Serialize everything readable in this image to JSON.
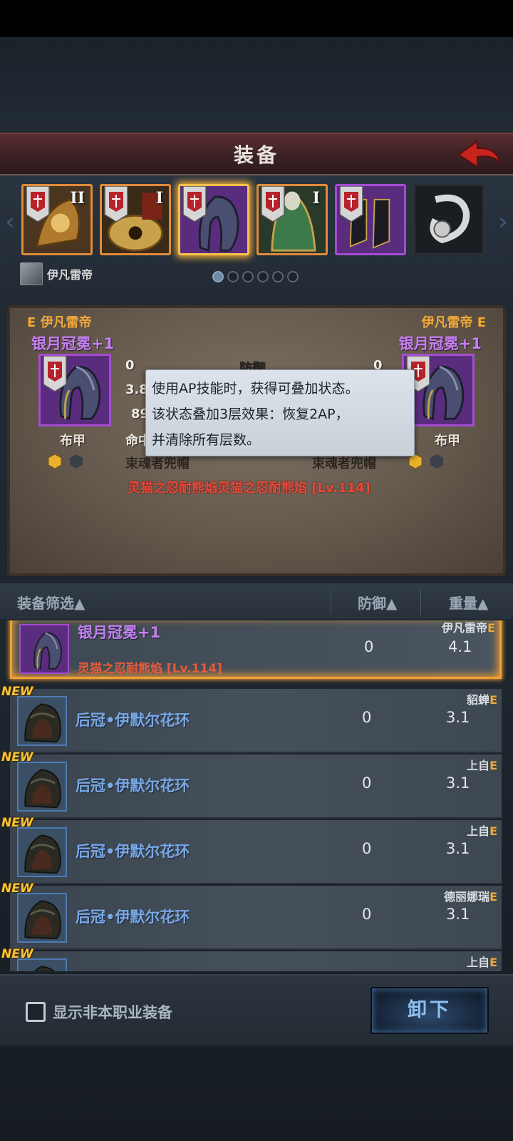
{
  "header": {
    "title": "装备"
  },
  "slots": [
    {
      "tier": "II",
      "border": "orange"
    },
    {
      "tier": "I",
      "border": "orange"
    },
    {
      "tier": "",
      "border": "orange",
      "selected": true
    },
    {
      "tier": "I",
      "border": "orange"
    },
    {
      "tier": "",
      "border": "purple"
    },
    {
      "tier": "",
      "border": "gray"
    }
  ],
  "character": {
    "name": "伊凡雷帝"
  },
  "pager": {
    "count": 6,
    "active": 0
  },
  "compare": {
    "left": {
      "owner": "E 伊凡雷帝",
      "item_name": "银月冠冕+1",
      "type": "布甲",
      "stats": [
        "0",
        "3.8",
        "89",
        "命中"
      ],
      "set": "束魂者兜帽"
    },
    "right": {
      "owner": "伊凡雷帝 E",
      "item_name": "银月冠冕+1",
      "type": "布甲",
      "stats": [
        "0",
        "",
        ""
      ],
      "set": "束魂者兜帽"
    },
    "center_label": "防御",
    "skill": "灵猫之忍耐熊焰灵猫之忍耐熊焰 [Lv.114]"
  },
  "tooltip": {
    "lines": [
      "使用AP技能时，获得可叠加状态。",
      "该状态叠加3层效果：恢复2AP，",
      "并清除所有层数。"
    ]
  },
  "list_header": {
    "filter": "装备筛选▲",
    "defense": "防御▲",
    "weight": "重量▲"
  },
  "items": [
    {
      "name": "银月冠冕+1",
      "skill": "灵猫之忍耐熊焰 [Lv.114]",
      "owner": "伊凡雷帝",
      "grade": "E",
      "defense": "0",
      "weight": "4.1",
      "is_new": false,
      "selected": true
    },
    {
      "name": "后冠•伊默尔花环",
      "skill": "",
      "owner": "貂蝉",
      "grade": "E",
      "defense": "0",
      "weight": "3.1",
      "is_new": true,
      "selected": false
    },
    {
      "name": "后冠•伊默尔花环",
      "skill": "",
      "owner": "上自",
      "grade": "E",
      "defense": "0",
      "weight": "3.1",
      "is_new": true,
      "selected": false
    },
    {
      "name": "后冠•伊默尔花环",
      "skill": "",
      "owner": "上自",
      "grade": "E",
      "defense": "0",
      "weight": "3.1",
      "is_new": true,
      "selected": false
    },
    {
      "name": "后冠•伊默尔花环",
      "skill": "",
      "owner": "德丽娜瑞",
      "grade": "E",
      "defense": "0",
      "weight": "3.1",
      "is_new": true,
      "selected": false
    },
    {
      "name": "",
      "skill": "",
      "owner": "上自",
      "grade": "E",
      "defense": "",
      "weight": "",
      "is_new": true,
      "selected": false
    }
  ],
  "new_badge": "NEW",
  "footer": {
    "checkbox_label": "显示非本职业装备",
    "unequip_label": "卸下"
  },
  "colors": {
    "accent_orange": "#f0a036",
    "epic_purple": "#a54cd0",
    "rare_blue": "#78a8e6",
    "skill_red": "#e84838"
  }
}
